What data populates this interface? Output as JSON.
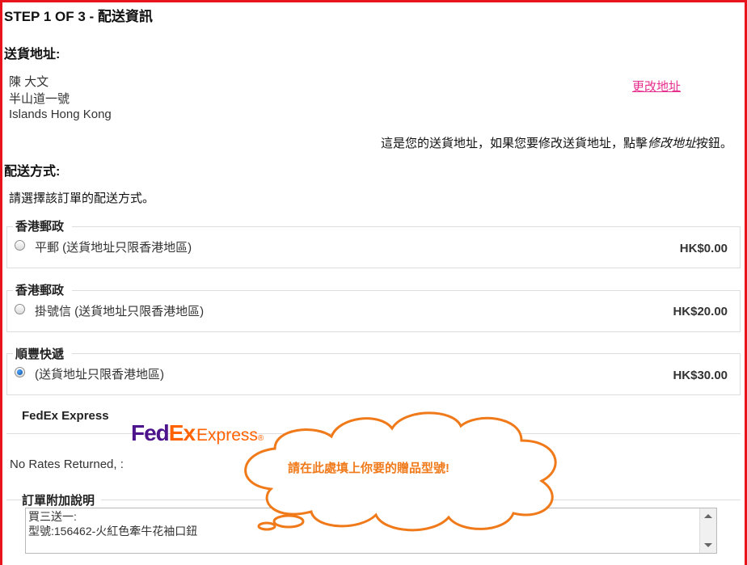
{
  "step_title": "STEP 1 OF 3 - 配送資訊",
  "shipping_address": {
    "title": "送貨地址:",
    "lines": [
      "陳  大文",
      "半山道一號",
      "Islands Hong Kong"
    ],
    "change_link": "更改地址",
    "note_prefix": "這是您的送貨地址，如果您要修改送貨地址，點擊",
    "note_emph": "修改地址",
    "note_suffix": "按鈕。"
  },
  "shipping_method": {
    "title": "配送方式:",
    "instruction": "請選擇該訂單的配送方式。",
    "options": [
      {
        "group": "香港郵政",
        "label": "平郵  (送貨地址只限香港地區)",
        "price": "HK$0.00",
        "selected": false
      },
      {
        "group": "香港郵政",
        "label": "掛號信  (送貨地址只限香港地區)",
        "price": "HK$20.00",
        "selected": false
      },
      {
        "group": "順豐快遞",
        "label": "(送貨地址只限香港地區)",
        "price": "HK$30.00",
        "selected": true
      }
    ],
    "fedex": {
      "group": "FedEx Express",
      "logo_fe": "Fed",
      "logo_ex": "Ex",
      "logo_express": "Express",
      "logo_reg": "®",
      "message": "No Rates Returned, :"
    }
  },
  "order_note": {
    "title": "訂單附加說明",
    "value": "買三送一:\n型號:156462-火紅色牽牛花袖口鈕"
  },
  "callout": {
    "text": "請在此處填上你要的贈品型號!",
    "color": "#f07a1a"
  },
  "colors": {
    "frame": "#e8141b",
    "link": "#e62e8c",
    "fedex_purple": "#4d148c",
    "fedex_orange": "#ff6200"
  }
}
